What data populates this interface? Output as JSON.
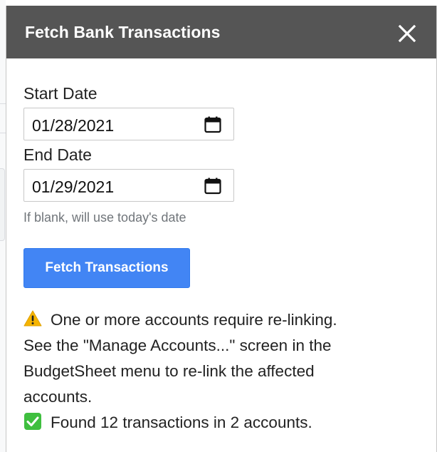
{
  "dialog": {
    "title": "Fetch Bank Transactions",
    "close_icon": "close-icon"
  },
  "form": {
    "start_date_label": "Start Date",
    "start_date_value": "01/28/2021",
    "end_date_label": "End Date",
    "end_date_value": "01/29/2021",
    "hint": "If blank, will use today's date",
    "fetch_button_label": "Fetch Transactions"
  },
  "status": {
    "warning_icon": "warning-icon",
    "warning_line1": "One or more accounts require re-linking.",
    "warning_line2": "See the \"Manage Accounts...\" screen in the",
    "warning_line3": "BudgetSheet menu to re-link the affected",
    "warning_line4": "accounts.",
    "success_icon": "check-mark-icon",
    "success_text": "Found 12 transactions in 2 accounts."
  },
  "colors": {
    "titlebar": "#555555",
    "button": "#4285f4",
    "warning": "#f5b400",
    "success": "#3fbf3f"
  }
}
